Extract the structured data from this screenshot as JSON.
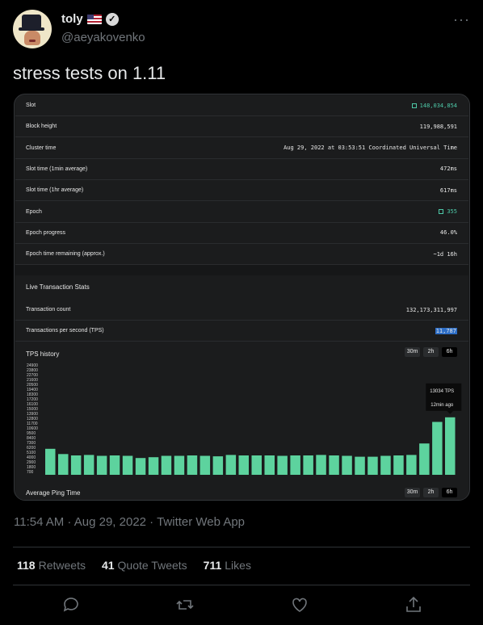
{
  "author": {
    "name": "toly",
    "flag": "🇺🇸",
    "handle": "@aeyakovenko"
  },
  "tweet": {
    "text": "stress tests on 1.11",
    "timestamp": "11:54 AM · Aug 29, 2022 · Twitter Web App"
  },
  "stats_panel": {
    "rows": [
      {
        "label": "Slot",
        "value": "148,034,854",
        "copy": true
      },
      {
        "label": "Block height",
        "value": "119,988,591"
      },
      {
        "label": "Cluster time",
        "value": "Aug 29, 2022 at 03:53:51 Coordinated Universal Time"
      },
      {
        "label": "Slot time (1min average)",
        "value": "472ms"
      },
      {
        "label": "Slot time (1hr average)",
        "value": "617ms"
      },
      {
        "label": "Epoch",
        "value": "355",
        "copy": true
      },
      {
        "label": "Epoch progress",
        "value": "46.0%"
      },
      {
        "label": "Epoch time remaining (approx.)",
        "value": "~1d 16h"
      }
    ]
  },
  "live_stats": {
    "title": "Live Transaction Stats",
    "tx_count_label": "Transaction count",
    "tx_count_value": "132,173,311,997",
    "tps_label": "Transactions per second (TPS)",
    "tps_value": "11,787",
    "history_title": "TPS history",
    "range_buttons": [
      "30m",
      "2h",
      "6h"
    ],
    "ping_title": "Average Ping Time",
    "tooltip": {
      "tps": "13034 TPS",
      "time": "12min ago"
    }
  },
  "chart_data": {
    "type": "bar",
    "title": "TPS history",
    "y_ticks": [
      700,
      1800,
      2900,
      4000,
      5100,
      6200,
      7300,
      8400,
      9500,
      10600,
      11700,
      12800,
      13900,
      15000,
      16100,
      17200,
      18300,
      19400,
      20500,
      21600,
      22700,
      23800,
      24900
    ],
    "ylim": [
      0,
      24900
    ],
    "values": [
      5900,
      4700,
      4400,
      4500,
      4300,
      4400,
      4300,
      3800,
      4000,
      4300,
      4300,
      4400,
      4300,
      4200,
      4500,
      4400,
      4400,
      4400,
      4300,
      4400,
      4400,
      4500,
      4400,
      4300,
      4100,
      4100,
      4300,
      4400,
      4500,
      7100,
      12000,
      13034
    ],
    "highlight_index": 31
  },
  "engagement": {
    "retweets": "118",
    "retweets_label": "Retweets",
    "quotes": "41",
    "quotes_label": "Quote Tweets",
    "likes": "711",
    "likes_label": "Likes"
  },
  "colors": {
    "bar": "#5dd39e",
    "accent": "#4ec9a8",
    "background": "#000000"
  }
}
